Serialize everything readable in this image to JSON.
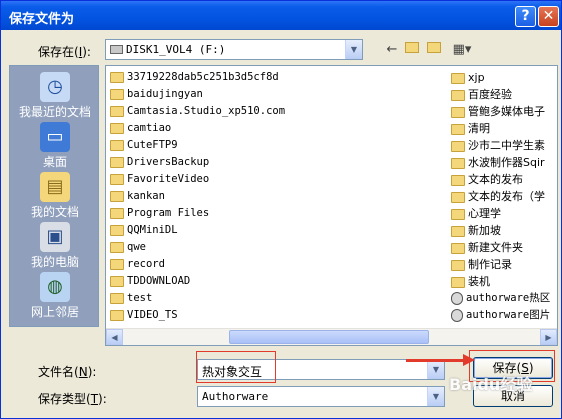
{
  "window": {
    "title": "保存文件为",
    "help_glyph": "?",
    "close_glyph": "✕"
  },
  "save_in": {
    "label": "保存在",
    "hotkey": "I",
    "value": "DISK1_VOL4  (F:)"
  },
  "places": [
    {
      "label": "我最近的文档",
      "icon": "recent-docs-icon"
    },
    {
      "label": "桌面",
      "icon": "desktop-icon"
    },
    {
      "label": "我的文档",
      "icon": "my-documents-icon"
    },
    {
      "label": "我的电脑",
      "icon": "my-computer-icon"
    },
    {
      "label": "网上邻居",
      "icon": "network-places-icon"
    }
  ],
  "files_left": [
    "33719228dab5c251b3d5cf8d",
    "baidujingyan",
    "Camtasia.Studio_xp510.com",
    "camtiao",
    "CuteFTP9",
    "DriversBackup",
    "FavoriteVideo",
    "kankan",
    "Program Files",
    "QQMiniDL",
    "qwe",
    "record",
    "TDDOWNLOAD",
    "test",
    "VIDEO_TS"
  ],
  "files_right": [
    {
      "name": "xjp",
      "type": "folder"
    },
    {
      "name": "百度经验",
      "type": "folder"
    },
    {
      "name": "管鲍多媒体电子",
      "type": "folder"
    },
    {
      "name": "清明",
      "type": "folder"
    },
    {
      "name": "沙市二中学生素",
      "type": "folder"
    },
    {
      "name": "水波制作器Sqir",
      "type": "folder"
    },
    {
      "name": "文本的发布",
      "type": "folder"
    },
    {
      "name": "文本的发布（学",
      "type": "folder"
    },
    {
      "name": "心理学",
      "type": "folder"
    },
    {
      "name": "新加坡",
      "type": "folder"
    },
    {
      "name": "新建文件夹",
      "type": "folder"
    },
    {
      "name": "制作记录",
      "type": "folder"
    },
    {
      "name": "装机",
      "type": "folder"
    },
    {
      "name": "authorware热区",
      "type": "file"
    },
    {
      "name": "authorware图片",
      "type": "file"
    }
  ],
  "filename": {
    "label": "文件名",
    "hotkey": "N",
    "value": "热对象交互"
  },
  "filetype": {
    "label": "保存类型",
    "hotkey": "T",
    "value": "Authorware"
  },
  "buttons": {
    "save": "保存",
    "save_hotkey": "S",
    "cancel": "取消"
  },
  "watermark": "Baidu经验"
}
